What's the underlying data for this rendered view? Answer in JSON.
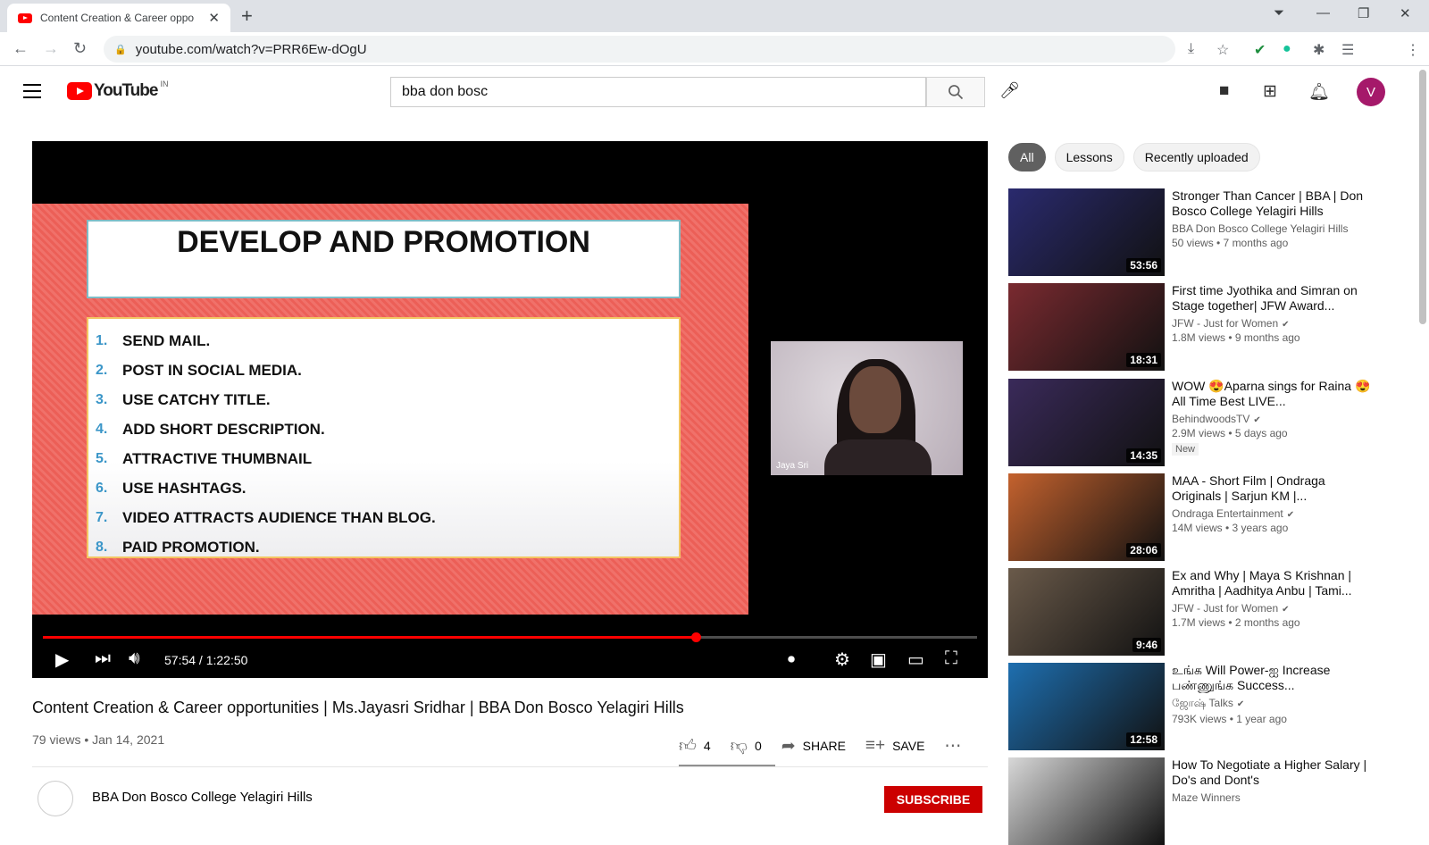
{
  "browser": {
    "tab_title": "Content Creation & Career oppo",
    "url": "youtube.com/watch?v=PRR6Ew-dOgU",
    "profile_initial": "V"
  },
  "header": {
    "logo_text": "YouTube",
    "country_code": "IN",
    "search_value": "bba don bosc",
    "avatar_initial": "V"
  },
  "player": {
    "slide_title": "DEVELOP AND PROMOTION",
    "slide_items": [
      {
        "n": "1.",
        "text": "SEND MAIL."
      },
      {
        "n": "2.",
        "text": "POST IN SOCIAL MEDIA."
      },
      {
        "n": "3.",
        "text": "USE CATCHY TITLE."
      },
      {
        "n": "4.",
        "text": "ADD SHORT DESCRIPTION."
      },
      {
        "n": "5.",
        "text": "ATTRACTIVE THUMBNAIL"
      },
      {
        "n": "6.",
        "text": "USE HASHTAGS."
      },
      {
        "n": "7.",
        "text": "VIDEO ATTRACTS  AUDIENCE THAN BLOG."
      },
      {
        "n": "8.",
        "text": "PAID PROMOTION."
      }
    ],
    "participant_name": "Jaya Sri",
    "time_display": "57:54 / 1:22:50",
    "progress_fraction": 0.699
  },
  "video": {
    "title": "Content Creation & Career opportunities | Ms.Jayasri Sridhar | BBA Don Bosco Yelagiri Hills",
    "views_date": "79 views • Jan 14, 2021",
    "likes": "4",
    "dislikes": "0",
    "share_label": "SHARE",
    "save_label": "SAVE",
    "channel_name": "BBA Don Bosco College Yelagiri Hills",
    "subscribe_label": "SUBSCRIBE"
  },
  "sidebar": {
    "chips": [
      "All",
      "Lessons",
      "Recently uploaded"
    ],
    "recommendations": [
      {
        "title": "Stronger Than Cancer | BBA | Don Bosco College Yelagiri Hills",
        "channel": "BBA Don Bosco College Yelagiri Hills",
        "views": "50 views • 7 months ago",
        "duration": "53:56",
        "verified": false,
        "badge": "",
        "thumb_color": "#2a2a6e"
      },
      {
        "title": "First time Jyothika and Simran on Stage together| JFW Award...",
        "channel": "JFW - Just for Women",
        "views": "1.8M views • 9 months ago",
        "duration": "18:31",
        "verified": true,
        "badge": "",
        "thumb_color": "#7a2a30"
      },
      {
        "title": "WOW 😍Aparna sings for Raina 😍All Time Best LIVE...",
        "channel": "BehindwoodsTV",
        "views": "2.9M views • 5 days ago",
        "duration": "14:35",
        "verified": true,
        "badge": "New",
        "thumb_color": "#3a2a5a"
      },
      {
        "title": "MAA - Short Film | Ondraga Originals | Sarjun KM |...",
        "channel": "Ondraga Entertainment",
        "views": "14M views • 3 years ago",
        "duration": "28:06",
        "verified": true,
        "badge": "",
        "thumb_color": "#c4622e"
      },
      {
        "title": "Ex and Why | Maya S Krishnan | Amritha | Aadhitya Anbu | Tami...",
        "channel": "JFW - Just for Women",
        "views": "1.7M views • 2 months ago",
        "duration": "9:46",
        "verified": true,
        "badge": "",
        "thumb_color": "#6a5a4a"
      },
      {
        "title": "உங்க Will Power-ஐ Increase பண்ணுங்க Success...",
        "channel": "ஜோஷ் Talks",
        "views": "793K views • 1 year ago",
        "duration": "12:58",
        "verified": true,
        "badge": "",
        "thumb_color": "#1e6fb0"
      },
      {
        "title": "How To Negotiate a Higher Salary | Do's and Dont's",
        "channel": "Maze Winners",
        "views": "",
        "duration": "",
        "verified": false,
        "badge": "",
        "thumb_color": "#d8d8d8"
      }
    ]
  }
}
